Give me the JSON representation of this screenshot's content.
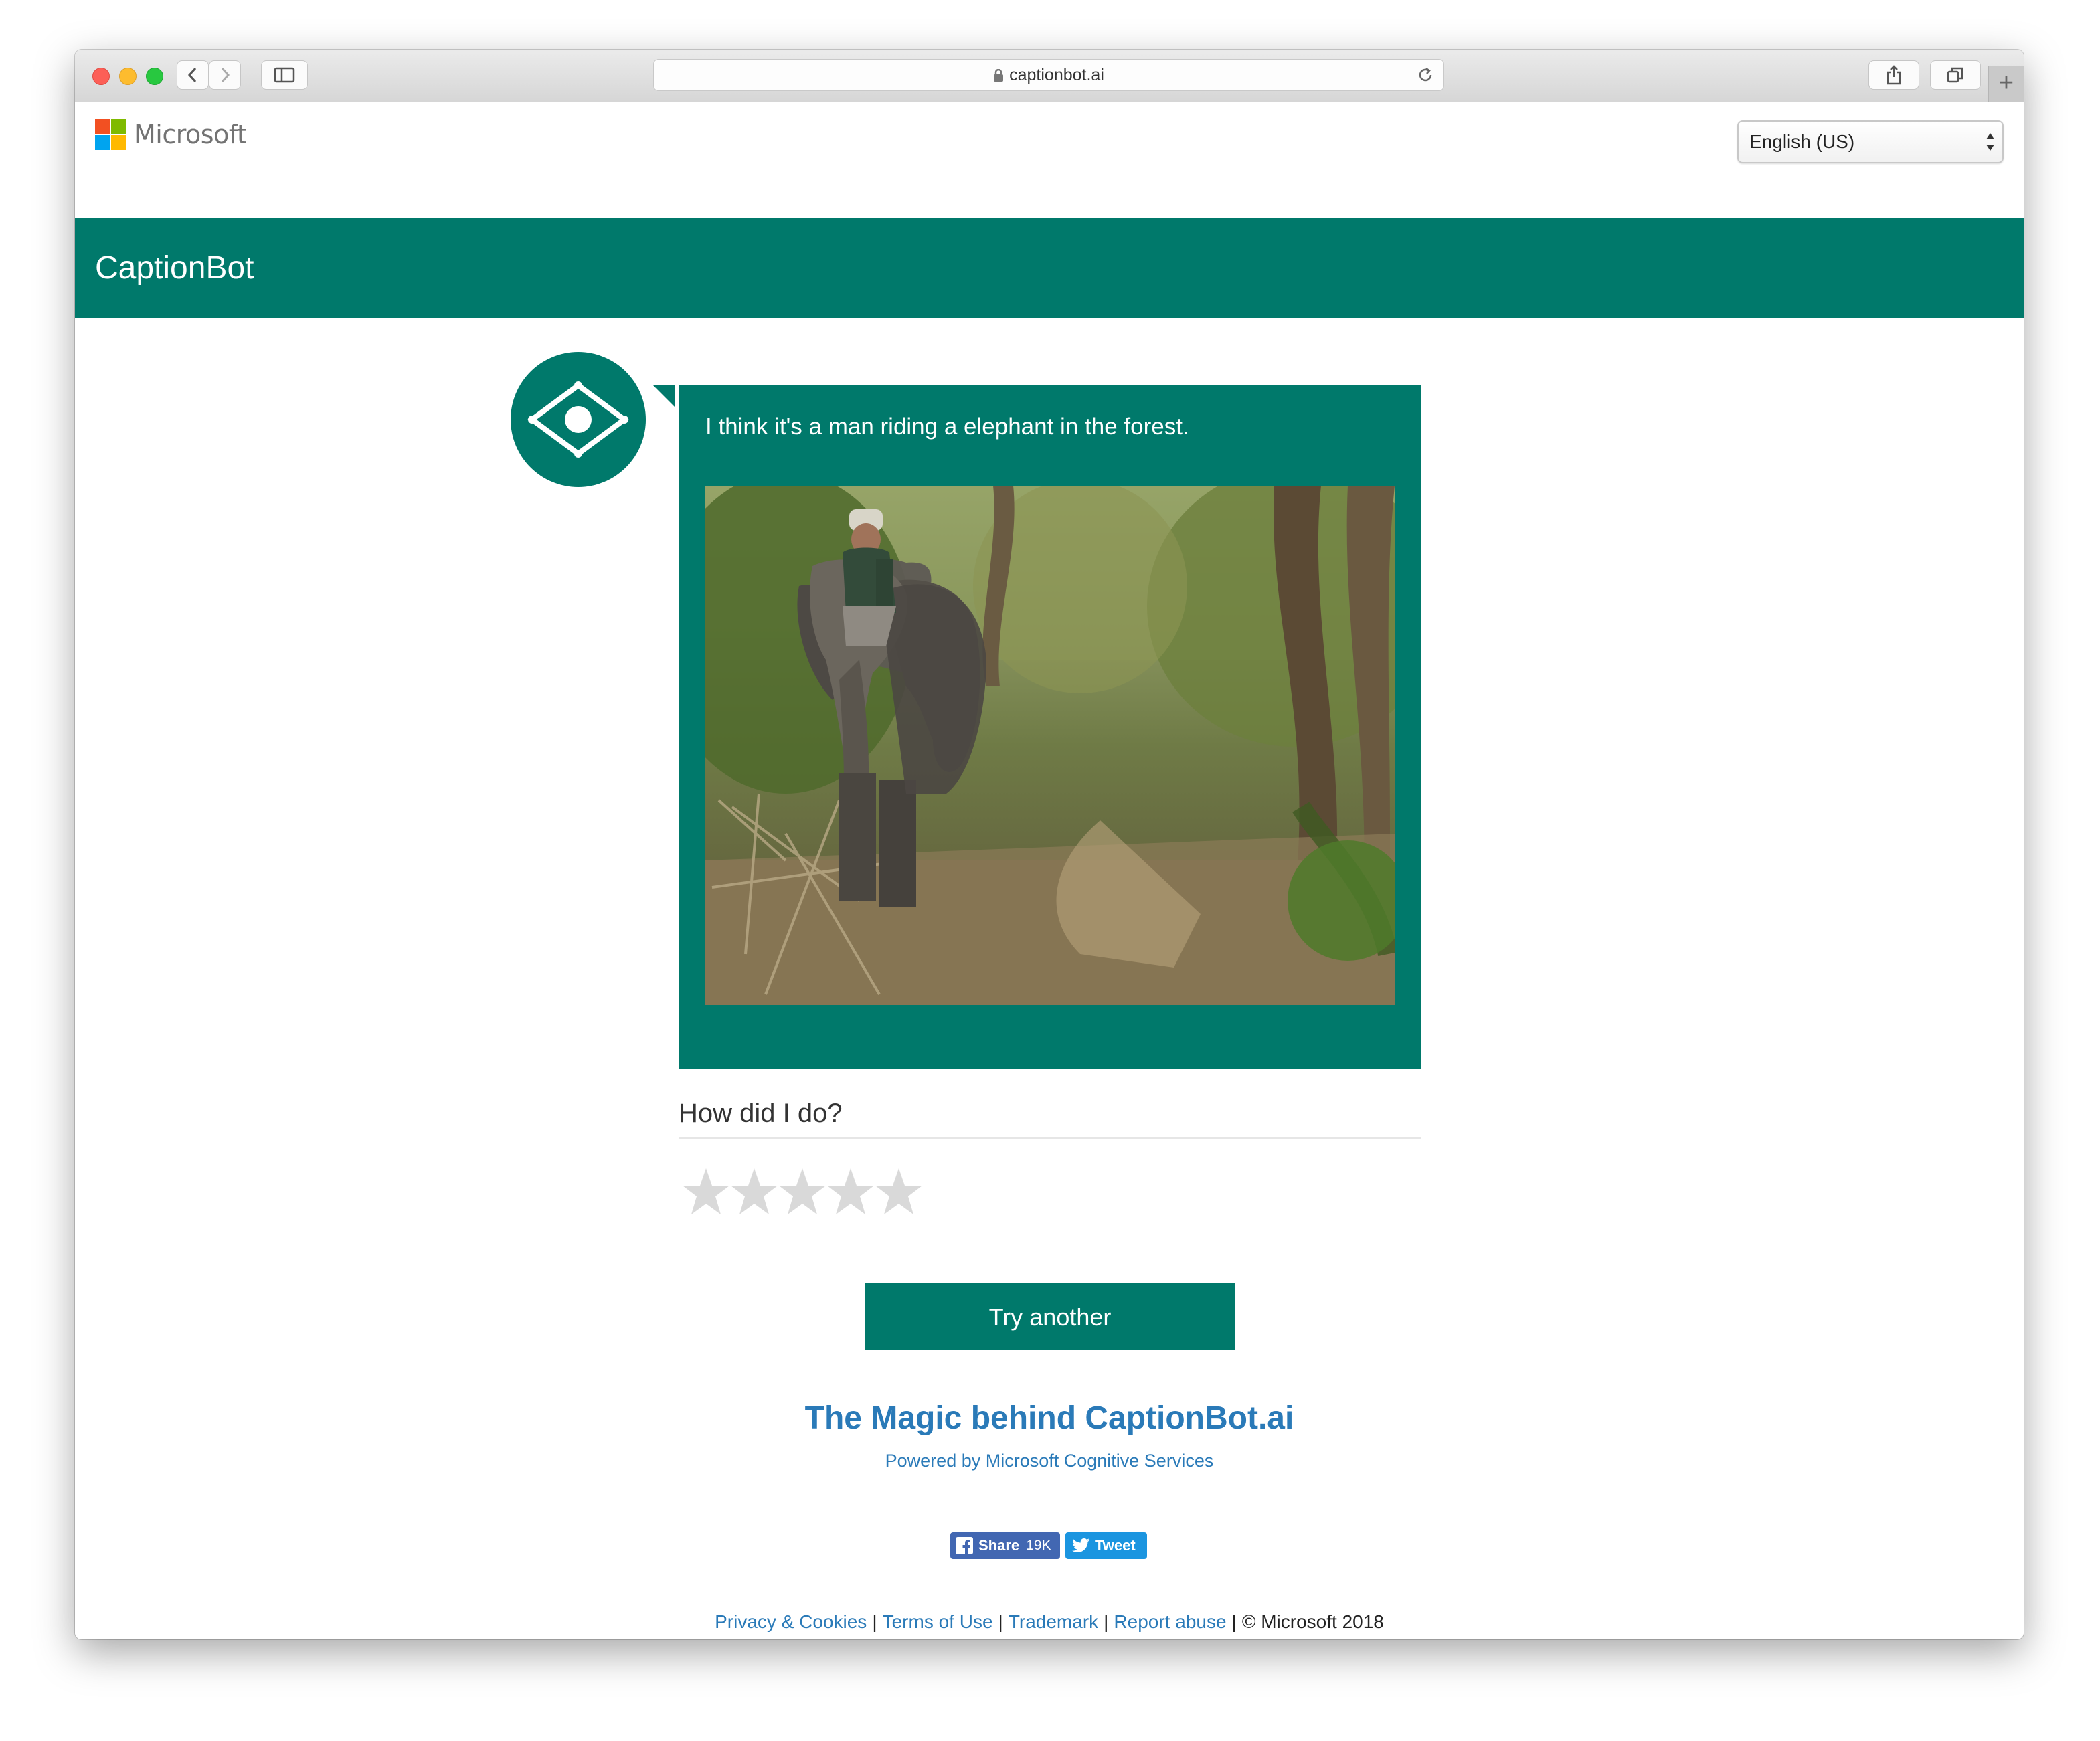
{
  "browser": {
    "url": "captionbot.ai"
  },
  "header": {
    "brand": "Microsoft",
    "language": "English (US)",
    "banner_title": "CaptionBot"
  },
  "result": {
    "caption": "I think it's a man riding a elephant in the forest.",
    "feedback_prompt": "How did I do?",
    "rating": 0,
    "max_rating": 5
  },
  "actions": {
    "try_another": "Try another"
  },
  "about": {
    "title": "The Magic behind CaptionBot.ai",
    "powered_by": "Powered by Microsoft Cognitive Services"
  },
  "social": {
    "facebook_label": "Share",
    "facebook_count": "19K",
    "twitter_label": "Tweet"
  },
  "footer": {
    "links": [
      "Privacy & Cookies",
      "Terms of Use",
      "Trademark",
      "Report abuse"
    ],
    "copyright": "© Microsoft 2018"
  },
  "colors": {
    "brand_teal": "#00796b",
    "link_blue": "#2a7ab8",
    "star_empty": "#d9d9d9"
  }
}
